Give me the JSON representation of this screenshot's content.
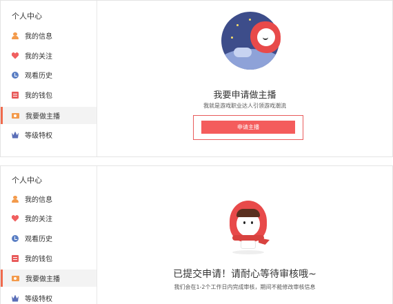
{
  "sidebar": {
    "title": "个人中心",
    "items": [
      {
        "label": "我的信息",
        "icon": "user-icon"
      },
      {
        "label": "我的关注",
        "icon": "heart-icon"
      },
      {
        "label": "观看历史",
        "icon": "clock-icon"
      },
      {
        "label": "我的钱包",
        "icon": "wallet-icon"
      },
      {
        "label": "我要做主播",
        "icon": "camera-icon",
        "active": true
      },
      {
        "label": "等级特权",
        "icon": "crown-icon"
      }
    ]
  },
  "apply_panel": {
    "title": "我要申请做主播",
    "subtitle": "我就是游戏职业达人引领游戏潮流",
    "button_label": "申请主播"
  },
  "pending_panel": {
    "title": "已提交申请！请耐心等待审核哦~",
    "subtitle": "我们会在1-2个工作日内完成审核，期间不能修改审核信息"
  },
  "colors": {
    "accent": "#f45c5c",
    "active_marker": "#f06a4c",
    "hood_red": "#e84a4a",
    "night_blue": "#3d4d8a"
  }
}
